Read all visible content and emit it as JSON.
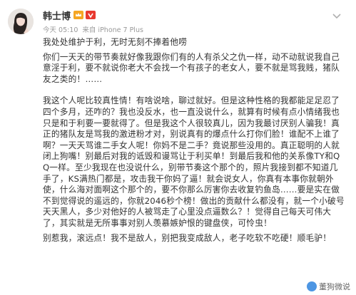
{
  "post": {
    "username": "韩士博",
    "badge_icons": [
      "vip-crown-icon",
      "weibo-level-icon"
    ],
    "time": "今天 05:10",
    "source": "来自 iPhone 7 Plus",
    "paragraphs": [
      "我处处维护于利，无时无刻不捧着他唠",
      "你们一天天的带节奏就好像我跟你们有的人有杀父之仇一样，动不动就说我自己意淫于利，要不就说你老大不会找一个有孩子的老女人，要不就是骂我贱，猪队友之类的！……",
      "我这个人呢比较真性情！有啥说啥，聊过就好。但是这种性格的我都能足足忍了四个多月，还咋的？我也没反水，也一直没说什么，就算有时候有点小情绪我也只是和于利要一要就得了。但是我这个人很较真儿，因为我最讨厌别人骗我！真正的猪队友是骂我的激进粉才对，别说真有的爆点什么打你们脸！谁配不上谁了啊？一天天骂谁二手女人呢！你妈不是二手？竟说那些没用的。真正聪明的人就闭上狗嘴！别最后对我的诋毁和谩骂让于利买单！到最后我和他的关系像TY和QQ一样。至少我现在也没说什么，别带节奏这个那个的，照片我接到都不知道几手了，KS满热门都是，攻击我干你妈了逼！就会说女人，你真有本事你就朝外使，什么海对面啊这个那个的，要不你那么厉害你去收复钓鱼岛……要是实在做不到觉得说的遥远的，你就2046秒个榜！做出的贡献什么都没有，就一个小破号天天黑人，多少对他好的人被骂走了心里没点逼数么？！觉得自己每天可伟大了，其实就是无所事事对别人羡慕嫉妒恨的键盘侠，可怜虫！",
      "别惹我，滚远点！我不是敌人，别把我变成敌人，老子吃软不吃硬！顺毛驴！"
    ],
    "watermark": "董狗微说"
  },
  "colors": {
    "name": "#333333",
    "meta": "#999999",
    "text": "#333333",
    "badge_red": "#e8392f",
    "badge_gold": "#f5a623"
  }
}
